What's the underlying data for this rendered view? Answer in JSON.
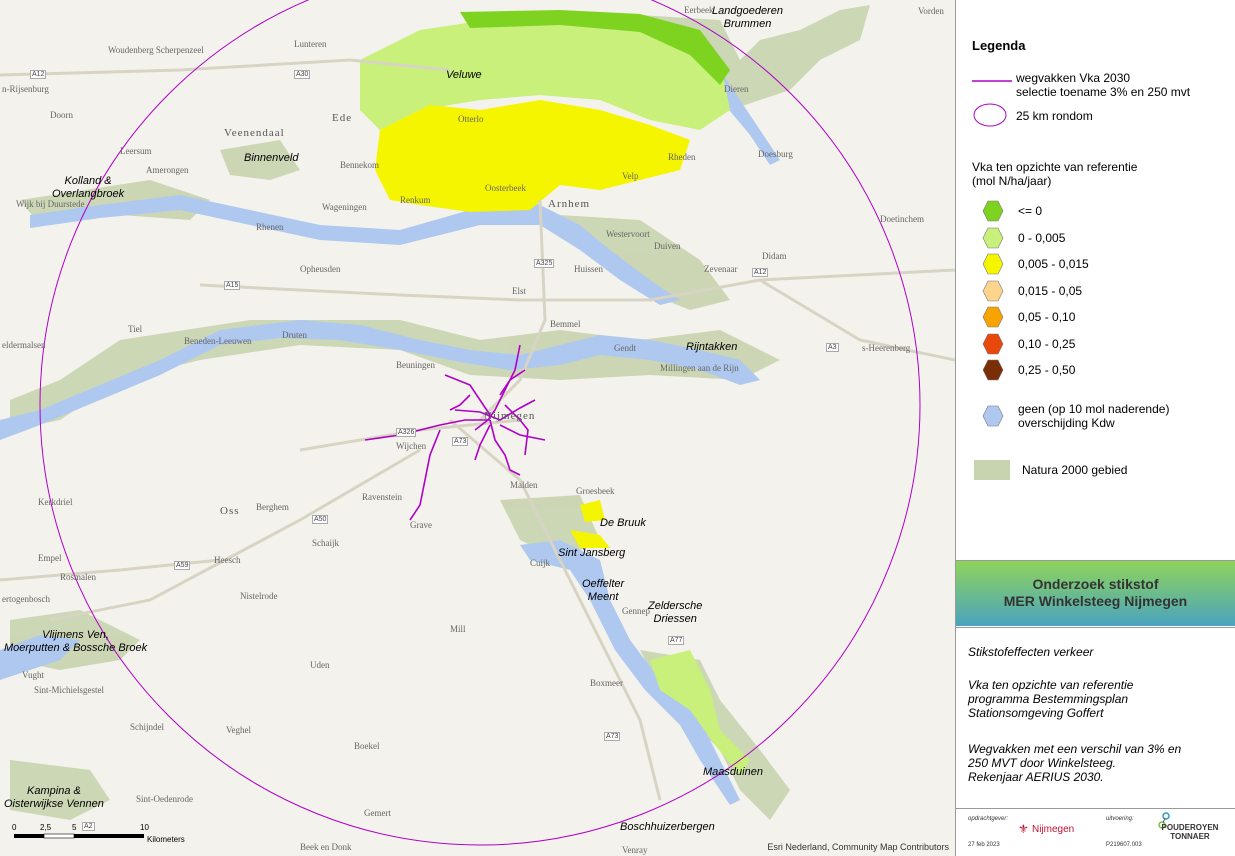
{
  "map": {
    "attribution": "Esri Nederland, Community Map Contributors",
    "scale": {
      "ticks": [
        "0",
        "2,5",
        "5",
        "10"
      ],
      "unit": "Kilometers"
    },
    "natura_labels": [
      {
        "id": "veluwe",
        "text": "Veluwe"
      },
      {
        "id": "landgoederen",
        "text": "Landgoederen\nBrummen"
      },
      {
        "id": "binnenveld",
        "text": "Binnenveld"
      },
      {
        "id": "kolland",
        "text": "Kolland &\nOverlangbroek"
      },
      {
        "id": "rijntakken",
        "text": "Rijntakken"
      },
      {
        "id": "debruuk",
        "text": "De Bruuk"
      },
      {
        "id": "sintjansberg",
        "text": "Sint Jansberg"
      },
      {
        "id": "oeffelter",
        "text": "Oeffelter\nMeent"
      },
      {
        "id": "zeldersche",
        "text": "Zeldersche\nDriessen"
      },
      {
        "id": "vlijmens",
        "text": "Vlijmens Ven,\nMoerputten & Bossche Broek"
      },
      {
        "id": "maasduinen",
        "text": "Maasduinen"
      },
      {
        "id": "kampina",
        "text": "Kampina &\nOisterwijkse Vennen"
      },
      {
        "id": "boschhuizer",
        "text": "Boschhuizerbergen"
      }
    ],
    "cities": [
      {
        "id": "arnhem",
        "text": "Arnhem"
      },
      {
        "id": "veenendaal",
        "text": "Veenendaal"
      },
      {
        "id": "oss",
        "text": "Oss"
      },
      {
        "id": "nijmegen",
        "text": "Nijmegen"
      },
      {
        "id": "ede",
        "text": "Ede"
      }
    ],
    "places": [
      {
        "id": "woudenberg",
        "text": "Woudenberg Scherpenzeel"
      },
      {
        "id": "lunteren",
        "text": "Lunteren"
      },
      {
        "id": "otterlo",
        "text": "Otterlo"
      },
      {
        "id": "rijsenburg",
        "text": "n-Rijsenburg"
      },
      {
        "id": "doorn",
        "text": "Doorn"
      },
      {
        "id": "leersum",
        "text": "Leersum"
      },
      {
        "id": "amerongen",
        "text": "Amerongen"
      },
      {
        "id": "wijk",
        "text": "Wijk bij Duurstede"
      },
      {
        "id": "bennekom",
        "text": "Bennekom"
      },
      {
        "id": "wageningen",
        "text": "Wageningen"
      },
      {
        "id": "renkum",
        "text": "Renkum"
      },
      {
        "id": "oosterbeek",
        "text": "Oosterbeek"
      },
      {
        "id": "velp",
        "text": "Velp"
      },
      {
        "id": "rheden",
        "text": "Rheden"
      },
      {
        "id": "dieren",
        "text": "Dieren"
      },
      {
        "id": "doesburg",
        "text": "Doesburg"
      },
      {
        "id": "doetinchem",
        "text": "Doetinchem"
      },
      {
        "id": "westervoort",
        "text": "Westervoort"
      },
      {
        "id": "duiven",
        "text": "Duiven"
      },
      {
        "id": "zevenaar",
        "text": "Zevenaar"
      },
      {
        "id": "didam",
        "text": "Didam"
      },
      {
        "id": "rhenen",
        "text": "Rhenen"
      },
      {
        "id": "ophemert",
        "text": "Opheusden"
      },
      {
        "id": "huissen",
        "text": "Huissen"
      },
      {
        "id": "elst",
        "text": "Elst"
      },
      {
        "id": "bemmel",
        "text": "Bemmel"
      },
      {
        "id": "gendt",
        "text": "Gendt"
      },
      {
        "id": "millingen",
        "text": "Millingen aan de Rijn"
      },
      {
        "id": "sheerenberg",
        "text": "s-Heerenberg"
      },
      {
        "id": "tiel",
        "text": "Tiel"
      },
      {
        "id": "geldermalsen",
        "text": "eldermalsen"
      },
      {
        "id": "beneden",
        "text": "Beneden-Leeuwen"
      },
      {
        "id": "druten",
        "text": "Druten"
      },
      {
        "id": "beuningen",
        "text": "Beuningen"
      },
      {
        "id": "wijchen",
        "text": "Wijchen"
      },
      {
        "id": "malden",
        "text": "Malden"
      },
      {
        "id": "groesbeek",
        "text": "Groesbeek"
      },
      {
        "id": "kerkdriel",
        "text": "Kerkdriel"
      },
      {
        "id": "berghem",
        "text": "Berghem"
      },
      {
        "id": "ravenstein",
        "text": "Ravenstein"
      },
      {
        "id": "grave",
        "text": "Grave"
      },
      {
        "id": "schaijk",
        "text": "Schaijk"
      },
      {
        "id": "heesch",
        "text": "Heesch"
      },
      {
        "id": "empel",
        "text": "Empel"
      },
      {
        "id": "rosmalen",
        "text": "Rosmalen"
      },
      {
        "id": "hertogenbosch",
        "text": "ertogenbosch"
      },
      {
        "id": "nistelrode",
        "text": "Nistelrode"
      },
      {
        "id": "cuijk",
        "text": "Cuijk"
      },
      {
        "id": "gennep",
        "text": "Gennep"
      },
      {
        "id": "mill",
        "text": "Mill"
      },
      {
        "id": "uden",
        "text": "Uden"
      },
      {
        "id": "boxmeer",
        "text": "Boxmeer"
      },
      {
        "id": "vught",
        "text": "Vught"
      },
      {
        "id": "stmichiel",
        "text": "Sint-Michielsgestel"
      },
      {
        "id": "schijndel",
        "text": "Schijndel"
      },
      {
        "id": "veghel",
        "text": "Veghel"
      },
      {
        "id": "boekel",
        "text": "Boekel"
      },
      {
        "id": "stoedenrode",
        "text": "Sint-Oedenrode"
      },
      {
        "id": "gemert",
        "text": "Gemert"
      },
      {
        "id": "beekendonk",
        "text": "Beek en Donk"
      },
      {
        "id": "venray",
        "text": "Venray"
      },
      {
        "id": "vorden",
        "text": "Vorden"
      },
      {
        "id": "eerbeek",
        "text": "Eerbeek"
      }
    ],
    "roads": [
      "A12",
      "A30",
      "A12",
      "A15",
      "A325",
      "A12",
      "A3",
      "A326",
      "A73",
      "A50",
      "A59",
      "A50",
      "A73",
      "A77",
      "A2"
    ]
  },
  "legend": {
    "title": "Legenda",
    "line_label": "wegvakken Vka 2030\nselectie toename 3% en 250 mvt",
    "circle_label": "25 km rondom",
    "class_heading": "Vka ten opzichte van referentie\n(mol N/ha/jaar)",
    "classes": [
      {
        "label": "<= 0",
        "color": "#7ed321"
      },
      {
        "label": "0 - 0,005",
        "color": "#c8f07a"
      },
      {
        "label": "0,005 - 0,015",
        "color": "#f5f500"
      },
      {
        "label": "0,015 - 0,05",
        "color": "#fcd48c"
      },
      {
        "label": "0,05 - 0,10",
        "color": "#f7a400"
      },
      {
        "label": "0,10 - 0,25",
        "color": "#e8480c"
      },
      {
        "label": "0,25 - 0,50",
        "color": "#7a2e05"
      }
    ],
    "none_label": "geen (op 10 mol naderende)\noverschijding Kdw",
    "none_color": "#aec8f0",
    "natura_label": "Natura 2000 gebied",
    "natura_color": "#c8d4b0",
    "line_color": "#b000c8"
  },
  "titleblock": {
    "line1": "Onderzoek stikstof",
    "line2": "MER Winkelsteeg Nijmegen"
  },
  "description": {
    "p1": "Stikstofeffecten verkeer",
    "p2": "Vka ten opzichte van referentie\nprogramma Bestemmingsplan\nStationsomgeving Goffert",
    "p3": "Wegvakken met een verschil van 3% en\n250 MVT door Winkelsteeg.\nRekenjaar AERIUS 2030."
  },
  "footer": {
    "client_label": "opdrachtgever:",
    "client": "Nijmegen",
    "date": "27 feb 2023",
    "exec_label": "uitvoering:",
    "exec": "POUDEROYEN TONNAER",
    "project": "P219607.003"
  }
}
